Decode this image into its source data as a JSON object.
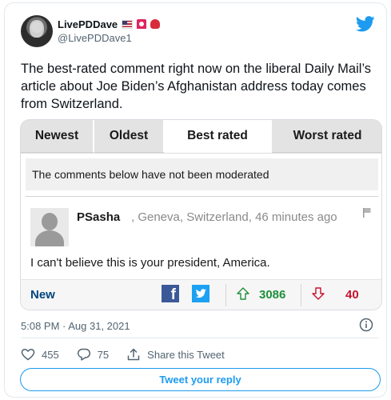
{
  "user": {
    "display_name": "LivePDDave",
    "handle": "@LivePDDave1",
    "name_emojis": [
      "flag-us-icon",
      "rotating-light-icon",
      "boxing-glove-icon"
    ]
  },
  "tweet": {
    "text": "The best-rated comment right now on the liberal Daily Mail’s article about Joe Biden’s Afghanistan address today comes from Switzerland.",
    "timestamp": "5:08 PM · Aug 31, 2021"
  },
  "media": {
    "tabs": [
      {
        "label": "Newest"
      },
      {
        "label": "Oldest"
      },
      {
        "label": "Best rated"
      },
      {
        "label": "Worst rated"
      }
    ],
    "active_tab": "Best rated",
    "notice": "The comments below have not been moderated",
    "comment": {
      "author": "PSasha",
      "meta": ", Geneva, Switzerland, 46 minutes ago",
      "body": "I can't believe this is your president, America.",
      "new_label": "New",
      "upvotes": "3086",
      "downvotes": "40"
    }
  },
  "actions": {
    "likes": "455",
    "replies": "75",
    "share_label": "Share this Tweet"
  },
  "reply_button": "Tweet your reply",
  "colors": {
    "twitter_blue": "#1d9bf0",
    "upvote_green": "#1f8f3a",
    "downvote_red": "#c8102e",
    "dm_new_blue": "#00457f"
  }
}
